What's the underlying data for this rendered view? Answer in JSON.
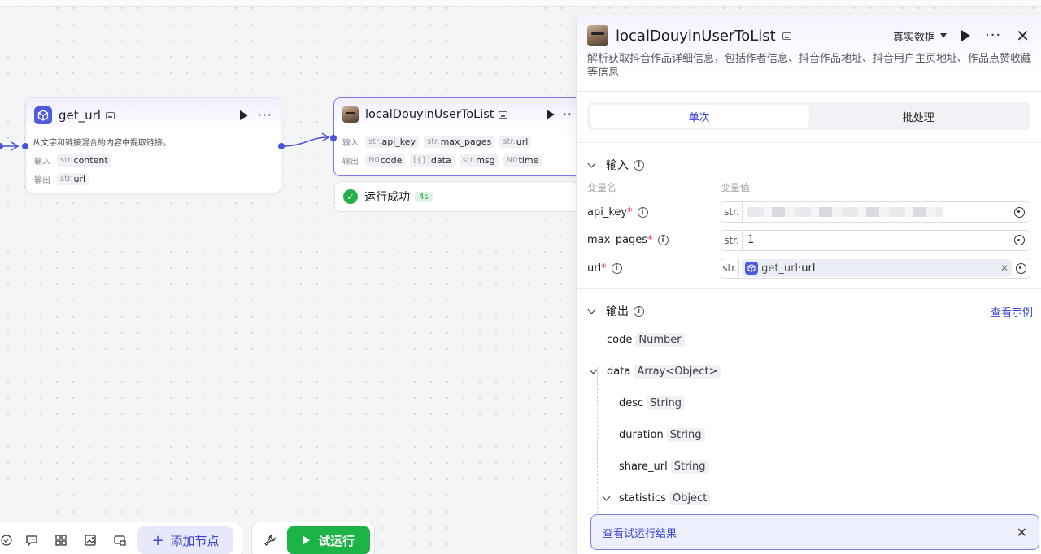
{
  "canvas": {
    "node1": {
      "title": "get_url",
      "description": "从文字和链接混合的内容中提取链接。",
      "input_label": "输入",
      "output_label": "输出",
      "inputs": [
        {
          "type": "str.",
          "name": "content"
        }
      ],
      "outputs": [
        {
          "type": "str.",
          "name": "url"
        }
      ]
    },
    "node2": {
      "title": "localDouyinUserToList",
      "input_label": "输入",
      "output_label": "输出",
      "inputs": [
        {
          "type": "str.",
          "name": "api_key"
        },
        {
          "type": "str.",
          "name": "max_pages"
        },
        {
          "type": "str.",
          "name": "url"
        }
      ],
      "outputs": [
        {
          "type": "N0",
          "name": "code"
        },
        {
          "type": "[{}]",
          "name": "data"
        },
        {
          "type": "str.",
          "name": "msg"
        },
        {
          "type": "N0",
          "name": "time"
        }
      ]
    },
    "status": {
      "text": "运行成功",
      "duration": "4s"
    }
  },
  "toolbar": {
    "add_node_label": "添加节点",
    "run_label": "试运行"
  },
  "panel": {
    "title": "localDouyinUserToList",
    "mode_label": "真实数据",
    "description": "解析获取抖音作品详细信息，包括作者信息、抖音作品地址、抖音用户主页地址、作品点赞收藏等信息",
    "tabs": [
      {
        "label": "单次",
        "active": true
      },
      {
        "label": "批处理",
        "active": false
      }
    ],
    "input_section": {
      "title": "输入",
      "col_name": "变量名",
      "col_value": "变量值",
      "rows": [
        {
          "name": "api_key",
          "type": "str.",
          "value": ""
        },
        {
          "name": "max_pages",
          "type": "str.",
          "value": "1"
        },
        {
          "name": "url",
          "type": "str.",
          "ref_node": "get_url",
          "ref_sep": " · ",
          "ref_var": "url"
        }
      ]
    },
    "output_section": {
      "title": "输出",
      "example_link": "查看示例",
      "rows": [
        {
          "name": "code",
          "type": "Number"
        },
        {
          "name": "data",
          "type": "Array<Object>"
        },
        {
          "name": "desc",
          "type": "String"
        },
        {
          "name": "duration",
          "type": "String"
        },
        {
          "name": "share_url",
          "type": "String"
        },
        {
          "name": "statistics",
          "type": "Object"
        }
      ]
    }
  },
  "result_bar": {
    "label": "查看试运行结果"
  },
  "colors": {
    "accent": "#4f5bdf",
    "run_green": "#1cb347",
    "success": "#24b048"
  }
}
